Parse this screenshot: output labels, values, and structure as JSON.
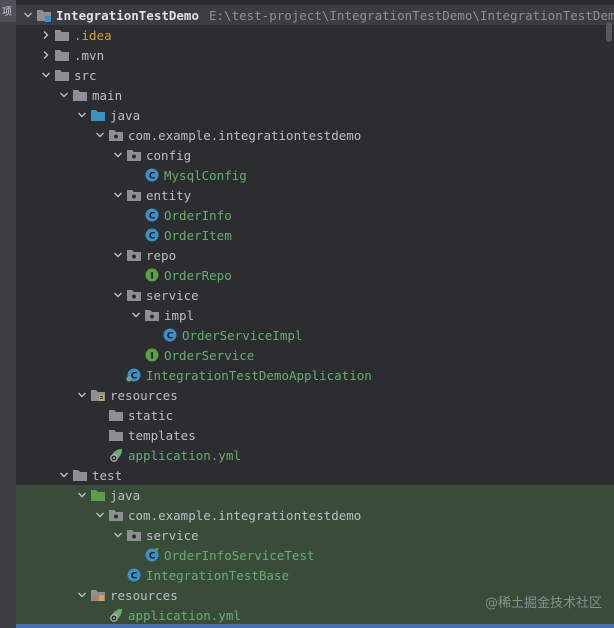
{
  "side_tab": {
    "label": "项"
  },
  "tree": {
    "rows": [
      {
        "label": "IntegrationTestDemo",
        "path": "E:\\test-project\\IntegrationTestDemo\\IntegrationTestDemo",
        "icon": "module-folder-icon",
        "depth": 0,
        "arrow": "down",
        "style": "b",
        "row": "sel"
      },
      {
        "label": ".idea",
        "icon": "folder-icon",
        "depth": 1,
        "arrow": "right",
        "style": "idea"
      },
      {
        "label": ".mvn",
        "icon": "folder-icon",
        "depth": 1,
        "arrow": "right"
      },
      {
        "label": "src",
        "icon": "folder-icon",
        "depth": 1,
        "arrow": "down"
      },
      {
        "label": "main",
        "icon": "folder-icon",
        "depth": 2,
        "arrow": "down"
      },
      {
        "label": "java",
        "icon": "source-folder-icon",
        "depth": 3,
        "arrow": "down"
      },
      {
        "label": "com.example.integrationtestdemo",
        "icon": "package-icon",
        "depth": 4,
        "arrow": "down"
      },
      {
        "label": "config",
        "icon": "package-icon",
        "depth": 5,
        "arrow": "down"
      },
      {
        "label": "MysqlConfig",
        "icon": "class-icon",
        "depth": 6,
        "style": "g"
      },
      {
        "label": "entity",
        "icon": "package-icon",
        "depth": 5,
        "arrow": "down"
      },
      {
        "label": "OrderInfo",
        "icon": "class-icon",
        "depth": 6,
        "style": "g"
      },
      {
        "label": "OrderItem",
        "icon": "class-icon",
        "depth": 6,
        "style": "g"
      },
      {
        "label": "repo",
        "icon": "package-icon",
        "depth": 5,
        "arrow": "down"
      },
      {
        "label": "OrderRepo",
        "icon": "interface-icon",
        "depth": 6,
        "style": "g"
      },
      {
        "label": "service",
        "icon": "package-icon",
        "depth": 5,
        "arrow": "down"
      },
      {
        "label": "impl",
        "icon": "package-icon",
        "depth": 6,
        "arrow": "down"
      },
      {
        "label": "OrderServiceImpl",
        "icon": "class-icon",
        "depth": 7,
        "style": "g"
      },
      {
        "label": "OrderService",
        "icon": "interface-icon",
        "depth": 6,
        "style": "g"
      },
      {
        "label": "IntegrationTestDemoApplication",
        "icon": "spring-class-icon",
        "depth": 5,
        "style": "g"
      },
      {
        "label": "resources",
        "icon": "resources-folder-icon",
        "depth": 3,
        "arrow": "down"
      },
      {
        "label": "static",
        "icon": "folder-icon",
        "depth": 4
      },
      {
        "label": "templates",
        "icon": "folder-icon",
        "depth": 4
      },
      {
        "label": "application.yml",
        "icon": "spring-config-icon",
        "depth": 4,
        "style": "g"
      },
      {
        "label": "test",
        "icon": "folder-icon",
        "depth": 2,
        "arrow": "down"
      },
      {
        "label": "java",
        "icon": "test-source-folder-icon",
        "depth": 3,
        "arrow": "down",
        "row": "hl"
      },
      {
        "label": "com.example.integrationtestdemo",
        "icon": "package-icon",
        "depth": 4,
        "arrow": "down",
        "row": "hl"
      },
      {
        "label": "service",
        "icon": "package-icon",
        "depth": 5,
        "arrow": "down",
        "row": "hl"
      },
      {
        "label": "OrderInfoServiceTest",
        "icon": "test-class-icon",
        "depth": 6,
        "style": "g",
        "row": "hl"
      },
      {
        "label": "IntegrationTestBase",
        "icon": "class-icon",
        "depth": 5,
        "style": "g",
        "row": "hl"
      },
      {
        "label": "resources",
        "icon": "test-resources-folder-icon",
        "depth": 3,
        "arrow": "down",
        "row": "hl"
      },
      {
        "label": "application.yml",
        "icon": "spring-config-icon",
        "depth": 4,
        "style": "g",
        "row": "hl"
      }
    ]
  },
  "watermark": {
    "text": "@稀土掘金技术社区"
  },
  "colors": {
    "background": "#2b2d30",
    "test_highlight": "#394c39",
    "green_text": "#6aab73",
    "class_icon": "#3d8fc7",
    "interface_icon": "#5b9e45",
    "folder": "#8c8f94",
    "source_folder": "#3d8fc7",
    "test_folder": "#5b9e45"
  }
}
